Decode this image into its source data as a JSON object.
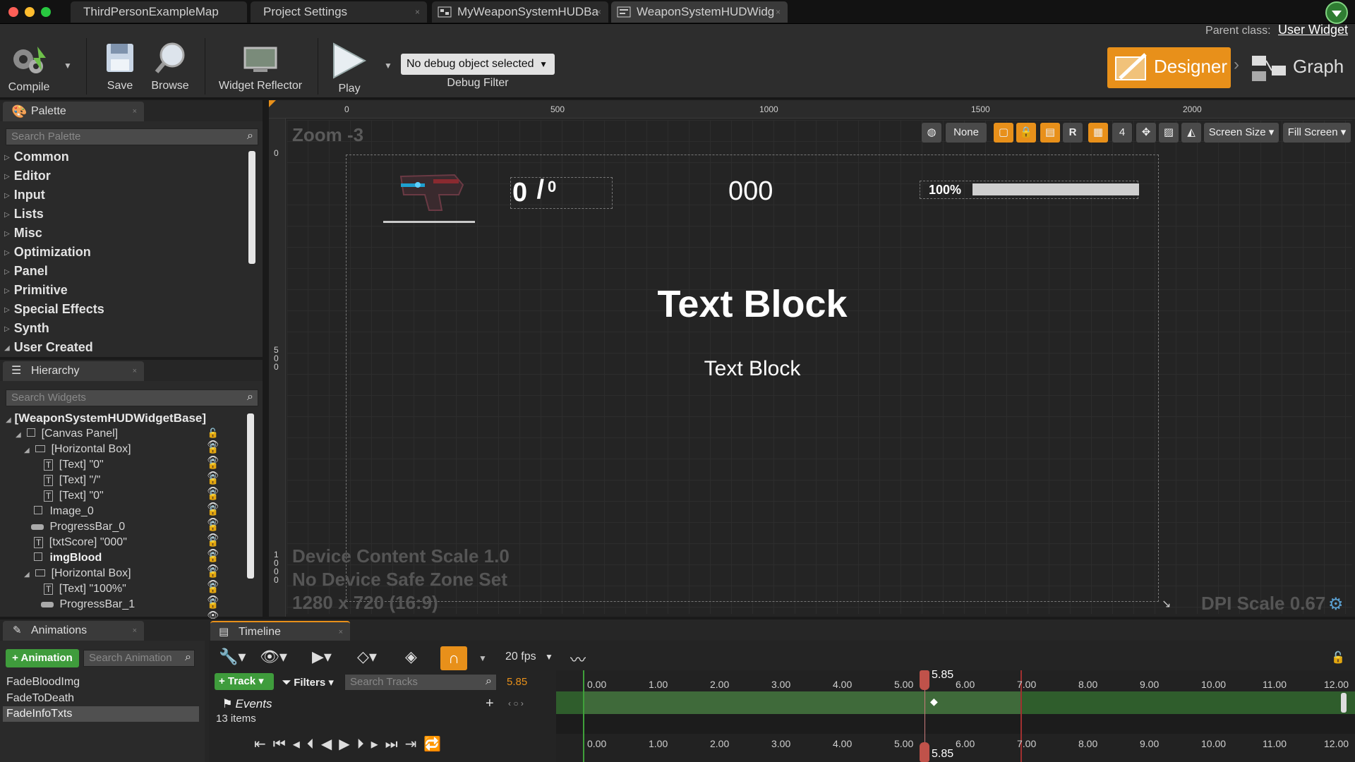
{
  "window": {
    "tabs": [
      "ThirdPersonExampleMap",
      "Project Settings",
      "MyWeaponSystemHUDBa",
      "WeaponSystemHUDWidg"
    ],
    "tab_close": "×",
    "parent_class_label": "Parent class:",
    "parent_class_value": "User Widget"
  },
  "toolbar": {
    "compile": "Compile",
    "save": "Save",
    "browse": "Browse",
    "widget_reflector": "Widget Reflector",
    "play": "Play",
    "debug_select": "No debug object selected",
    "debug_filter": "Debug Filter",
    "designer": "Designer",
    "graph": "Graph"
  },
  "palette": {
    "tab": "Palette",
    "search_placeholder": "Search Palette",
    "categories": [
      "Common",
      "Editor",
      "Input",
      "Lists",
      "Misc",
      "Optimization",
      "Panel",
      "Primitive",
      "Special Effects",
      "Synth",
      "User Created"
    ]
  },
  "hierarchy": {
    "tab": "Hierarchy",
    "search_placeholder": "Search Widgets",
    "items": [
      {
        "label": "[WeaponSystemHUDWidgetBase]",
        "icon": "blueprint-icon"
      },
      {
        "label": "[Canvas Panel]",
        "icon": "canvas-icon"
      },
      {
        "label": "[Horizontal Box]",
        "icon": "hbox-icon"
      },
      {
        "label": "[Text] \"0\"",
        "icon": "text-icon"
      },
      {
        "label": "[Text] \"/\"",
        "icon": "text-icon"
      },
      {
        "label": "[Text] \"0\"",
        "icon": "text-icon"
      },
      {
        "label": "Image_0",
        "icon": "image-icon"
      },
      {
        "label": "ProgressBar_0",
        "icon": "progressbar-icon"
      },
      {
        "label": "[txtScore] \"000\"",
        "icon": "text-icon"
      },
      {
        "label": "imgBlood",
        "icon": "image-icon"
      },
      {
        "label": "[Horizontal Box]",
        "icon": "hbox-icon"
      },
      {
        "label": "[Text] \"100%\"",
        "icon": "text-icon"
      },
      {
        "label": "ProgressBar_1",
        "icon": "progressbar-icon"
      }
    ]
  },
  "designer": {
    "zoom": "Zoom -3",
    "ruler_h": [
      "0",
      "500",
      "1000",
      "1500",
      "2000"
    ],
    "ruler_v": [
      "0",
      "5\n0\n0",
      "1\n0\n0\n0"
    ],
    "toolbar": {
      "none": "None",
      "r": "R",
      "grid_size": "4",
      "screen_size": "Screen Size",
      "fill_screen": "Fill Screen"
    },
    "widgets": {
      "ammo_current": "0",
      "ammo_sep": " / ",
      "ammo_max": "0",
      "score": "000",
      "health_pct": "100%",
      "health_fill": 1.0,
      "text_block_big": "Text Block",
      "text_block_small": "Text Block"
    },
    "device_info": [
      "Device Content Scale 1.0",
      "No Device Safe Zone Set",
      "1280 x 720 (16:9)"
    ],
    "dpi_scale": "DPI Scale 0.67"
  },
  "animations": {
    "tab": "Animations",
    "add_button": "+ Animation",
    "search_placeholder": "Search Animation",
    "items": [
      "FadeBloodImg",
      "FadeToDeath",
      "FadeInfoTxts"
    ],
    "selected_index": 2
  },
  "timeline": {
    "tab": "Timeline",
    "fps": "20 fps",
    "track_button": "+ Track",
    "filters": "Filters",
    "search_placeholder": "Search Tracks",
    "current_time": "5.85",
    "events_label": "Events",
    "items_count": "13 items",
    "ticks": [
      "0.00",
      "1.00",
      "2.00",
      "3.00",
      "4.00",
      "5.00",
      "6.00",
      "7.00",
      "8.00",
      "9.00",
      "10.00",
      "11.00",
      "12.00"
    ],
    "playhead_top": "5.85",
    "playhead_bottom": "5.85"
  }
}
